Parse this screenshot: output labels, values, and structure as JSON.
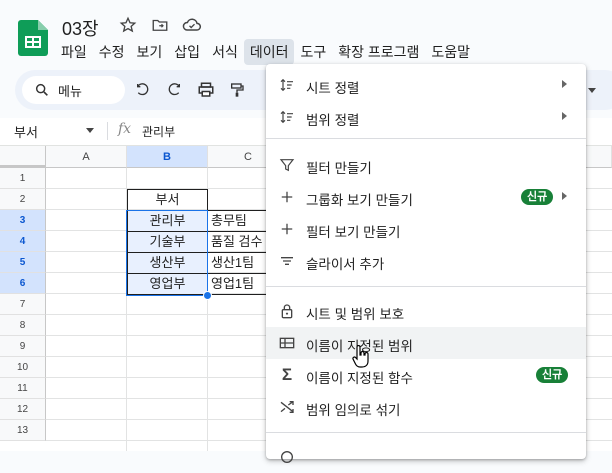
{
  "app": {
    "doc_title": "03장",
    "menu": [
      "파일",
      "수정",
      "보기",
      "삽입",
      "서식",
      "데이터",
      "도구",
      "확장 프로그램",
      "도움말"
    ],
    "active_menu": "데이터"
  },
  "toolbar": {
    "search_label": "메뉴"
  },
  "formula_bar": {
    "name_box": "부서",
    "fx": "fx",
    "value": "관리부"
  },
  "sheet": {
    "columns": [
      "A",
      "B",
      "C"
    ],
    "rows": [
      "1",
      "2",
      "3",
      "4",
      "5",
      "6",
      "7",
      "8",
      "9",
      "10",
      "11",
      "12",
      "13"
    ],
    "cells": {
      "B2": "부서",
      "B3": "관리부",
      "C3": "총무팀",
      "B4": "기술부",
      "C4": "품질 검수",
      "B5": "생산부",
      "C5": "생산1팀",
      "B6": "영업부",
      "C6": "영업1팀"
    }
  },
  "data_menu": {
    "items": [
      {
        "label": "시트 정렬",
        "icon": "sort-icon",
        "submenu": true
      },
      {
        "label": "범위 정렬",
        "icon": "sort-range-icon",
        "submenu": true
      },
      {
        "label": "필터 만들기",
        "icon": "filter-icon"
      },
      {
        "label": "그룹화 보기 만들기",
        "icon": "plus-icon",
        "badge": "신규",
        "submenu": true
      },
      {
        "label": "필터 보기 만들기",
        "icon": "plus-icon"
      },
      {
        "label": "슬라이서 추가",
        "icon": "slicer-icon"
      },
      {
        "label": "시트 및 범위 보호",
        "icon": "lock-icon"
      },
      {
        "label": "이름이 지정된 범위",
        "icon": "named-range-icon"
      },
      {
        "label": "이름이 지정된 함수",
        "icon": "sigma-icon",
        "badge": "신규"
      },
      {
        "label": "범위 임의로 섞기",
        "icon": "shuffle-icon"
      }
    ],
    "hovered": "이름이 지정된 범위"
  },
  "colors": {
    "accent": "#1a73e8",
    "badge": "#188038",
    "selection_bg": "#d3e3fd"
  }
}
